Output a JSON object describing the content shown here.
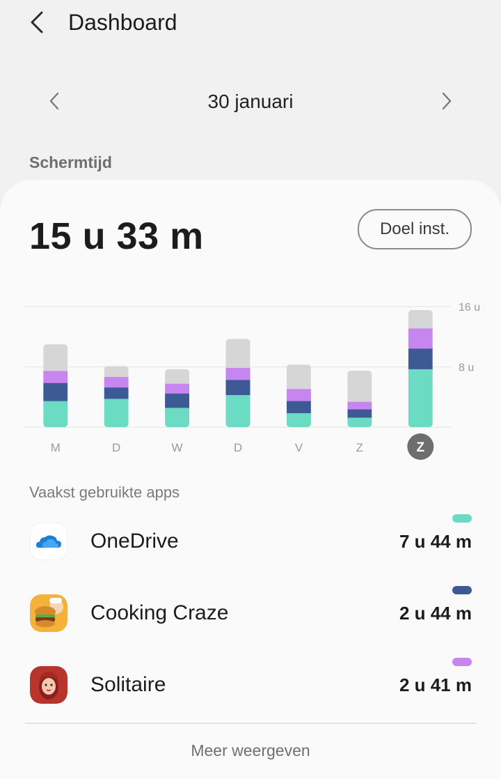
{
  "header": {
    "title": "Dashboard",
    "back_icon": "chevron-left-icon"
  },
  "date_nav": {
    "date": "30 januari",
    "prev_icon": "chevron-left-icon",
    "next_icon": "chevron-right-icon"
  },
  "section": {
    "screen_time_label": "Schermtijd"
  },
  "summary": {
    "total": "15 u 33 m",
    "goal_button": "Doel inst."
  },
  "colors": {
    "onedrive": "#6cdbc4",
    "cooking_craze": "#3e5a95",
    "solitaire": "#c785ef",
    "other": "#d6d6d6",
    "selected_day": "#6e6e6e"
  },
  "chart_data": {
    "type": "bar",
    "stacked": true,
    "categories": [
      "M",
      "D",
      "W",
      "D",
      "V",
      "Z",
      "Z"
    ],
    "selected_index": 6,
    "ylim": [
      0,
      16
    ],
    "y_ticks": [
      {
        "value": 16,
        "label": "16 u"
      },
      {
        "value": 8,
        "label": "8 u"
      }
    ],
    "grid": true,
    "series": [
      {
        "key": "onedrive",
        "values": [
          3.5,
          3.8,
          2.6,
          4.3,
          1.9,
          1.3,
          7.73
        ]
      },
      {
        "key": "cooking_craze",
        "values": [
          2.4,
          1.5,
          1.9,
          2.0,
          1.6,
          1.1,
          2.73
        ]
      },
      {
        "key": "solitaire",
        "values": [
          1.6,
          1.4,
          1.3,
          1.6,
          1.6,
          1.0,
          2.68
        ]
      },
      {
        "key": "other",
        "values": [
          3.5,
          1.4,
          1.9,
          3.8,
          3.2,
          4.1,
          2.4
        ]
      }
    ]
  },
  "apps": {
    "label": "Vaakst gebruikte apps",
    "items": [
      {
        "name": "OneDrive",
        "time": "7 u 44 m",
        "icon": "onedrive-icon",
        "color_key": "onedrive"
      },
      {
        "name": "Cooking Craze",
        "time": "2 u 44 m",
        "icon": "cooking-craze-icon",
        "color_key": "cooking_craze"
      },
      {
        "name": "Solitaire",
        "time": "2 u 41 m",
        "icon": "solitaire-icon",
        "color_key": "solitaire"
      }
    ],
    "more_link": "Meer weergeven"
  }
}
